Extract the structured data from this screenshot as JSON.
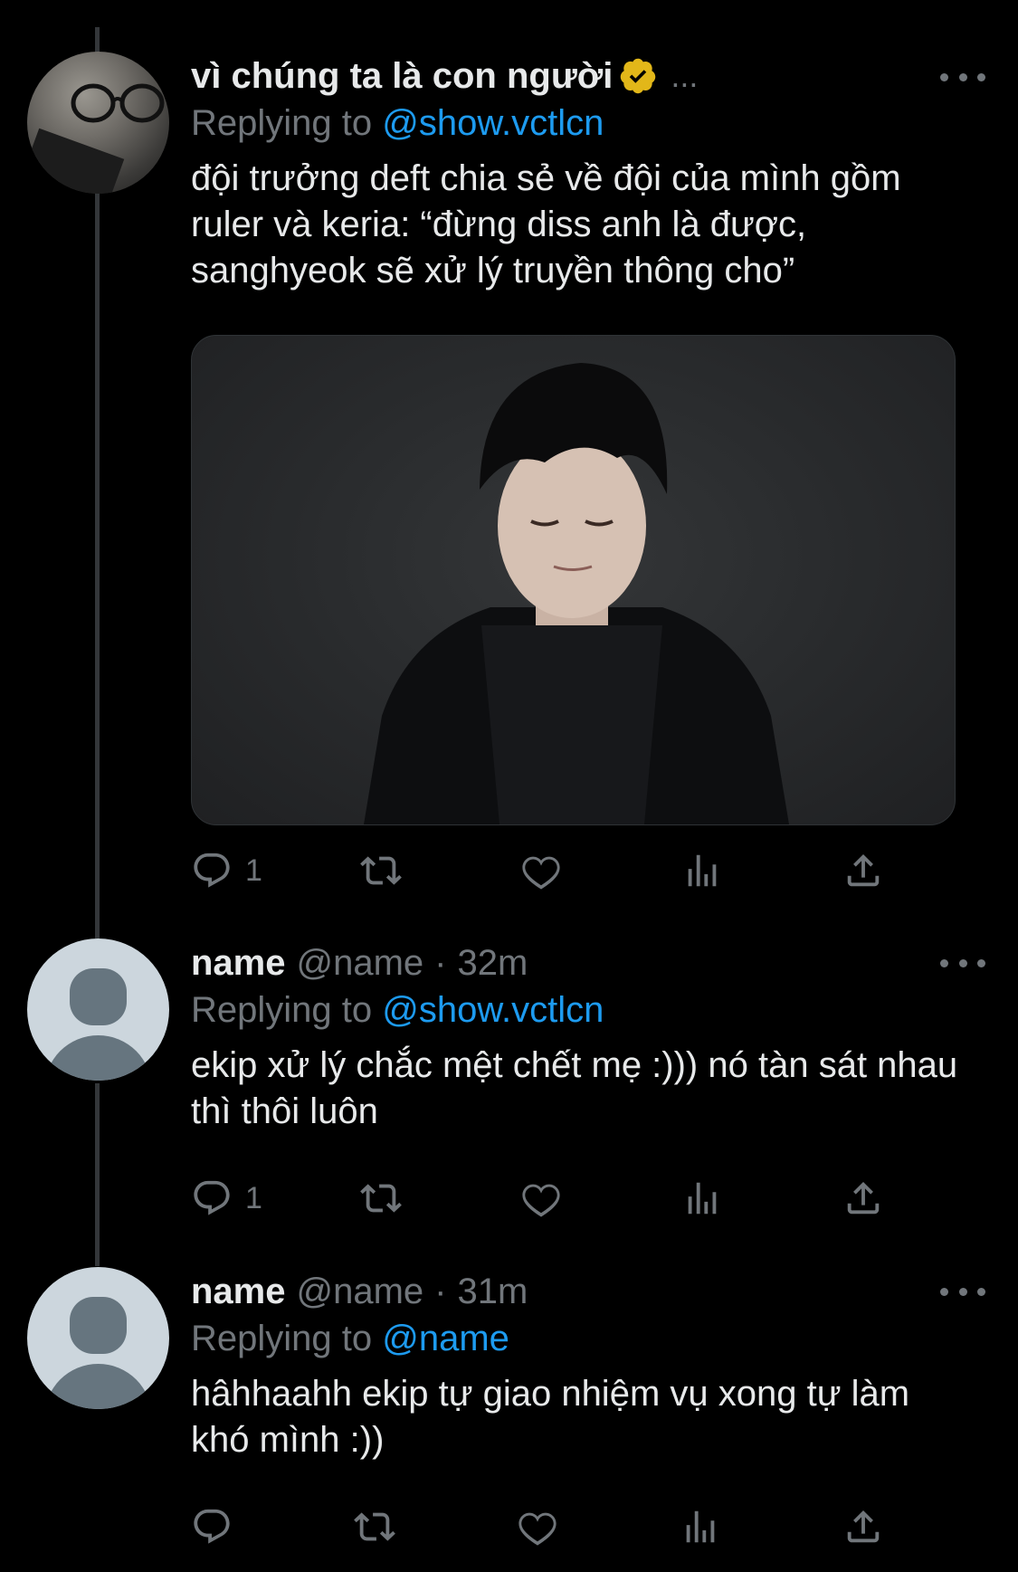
{
  "tweets": [
    {
      "display_name": "vì chúng ta là con người",
      "verified": true,
      "handle": "",
      "time": "",
      "trailing": "...",
      "replying_prefix": "Replying to",
      "replying_to": "@show.vctlcn",
      "text": "đội trưởng deft chia sẻ về đội của mình gồm ruler và keria: “đừng diss anh là được, sanghyeok sẽ xử lý truyền thông cho”",
      "has_media": true,
      "reply_count": "1"
    },
    {
      "display_name": "name",
      "verified": false,
      "handle": "@name",
      "time": "32m",
      "replying_prefix": "Replying to",
      "replying_to": "@show.vctlcn",
      "text": "ekip xử lý chắc mệt chết mẹ :))) nó tàn sát nhau thì thôi luôn",
      "has_media": false,
      "reply_count": "1"
    },
    {
      "display_name": "name",
      "verified": false,
      "handle": "@name",
      "time": "31m",
      "replying_prefix": "Replying to",
      "replying_to": "@name",
      "text": "hâhhaahh ekip tự giao nhiệm vụ xong tự làm khó mình :))",
      "has_media": false,
      "reply_count": ""
    }
  ],
  "separator": "·",
  "colors": {
    "background": "#000000",
    "text": "#e7e9ea",
    "muted": "#71767b",
    "link": "#1d9bf0",
    "verified_badge": "#e2b719",
    "thread_line": "#333639"
  },
  "icons": [
    "reply-icon",
    "retweet-icon",
    "like-icon",
    "views-icon",
    "share-icon",
    "more-icon",
    "verified-badge-icon"
  ]
}
